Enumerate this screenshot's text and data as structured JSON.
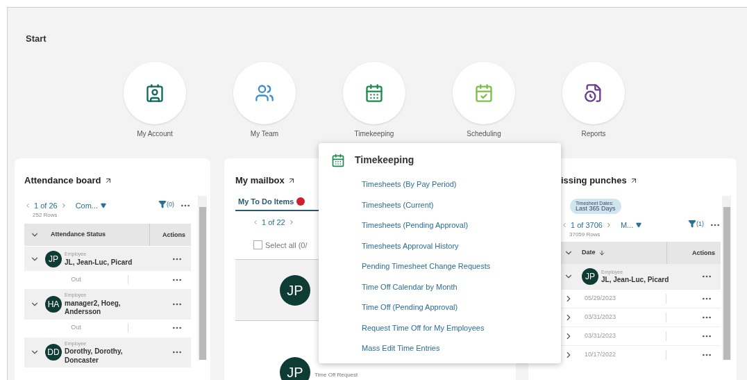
{
  "start": {
    "title": "Start",
    "tiles": [
      {
        "label": "My Account",
        "kind": "account"
      },
      {
        "label": "My Team",
        "kind": "team"
      },
      {
        "label": "Timekeeping",
        "kind": "timekeeping"
      },
      {
        "label": "Scheduling",
        "kind": "scheduling"
      },
      {
        "label": "Reports",
        "kind": "reports"
      }
    ]
  },
  "attendance_board": {
    "title": "Attendance board",
    "pager": "1 of 26",
    "row_count": "252 Rows",
    "view": "Com...",
    "filter_count": "(0)",
    "columns": [
      "Attendance Status",
      "Actions"
    ],
    "employees": [
      {
        "initials": "JP",
        "role": "Employee",
        "name": "JL, Jean-Luc, Picard",
        "expanded": true,
        "status": "Out"
      },
      {
        "initials": "HA",
        "role": "Employee",
        "name": "manager2, Hoeg, Andersson",
        "expanded": true,
        "status": "Out"
      },
      {
        "initials": "DD",
        "role": "Employee",
        "name": "Dorothy, Dorothy, Doncaster",
        "expanded": true
      }
    ]
  },
  "mailbox": {
    "title": "My mailbox",
    "tabs": [
      {
        "label": "My To Do Items",
        "selected": true
      }
    ],
    "pager": "1 of 22",
    "select_all": {
      "label": "Select all (0/",
      "checked": false
    },
    "items": [
      {
        "initials": "JP"
      },
      {
        "initials": "JP",
        "type": "Time Off Request"
      }
    ]
  },
  "missing_punches": {
    "title": "issing punches",
    "chip": [
      "Timesheet Dates:",
      "Last 365 Days"
    ],
    "pager": "1 of 3706",
    "row_count": "37059 Rows",
    "view": "M...",
    "filter_count": "(1)",
    "columns": [
      "Date",
      "Actions"
    ],
    "employee": {
      "initials": "JP",
      "role": "Employee",
      "name": "JL, Jean-Luc, Picard",
      "expanded": true
    },
    "rows": [
      {
        "date": "05/29/2023",
        "expanded": false
      },
      {
        "date": "03/31/2023",
        "expanded": false
      },
      {
        "date": "03/31/2023",
        "expanded": false
      },
      {
        "date": "10/17/2022",
        "expanded": false
      }
    ]
  },
  "timekeeping_menu": {
    "title": "Timekeeping",
    "links": [
      "Timesheets (By Pay Period)",
      "Timesheets (Current)",
      "Timesheets (Pending Approval)",
      "Timesheets Approval History",
      "Pending Timesheet Change Requests",
      "Time Off Calendar by Month",
      "Time Off (Pending Approval)",
      "Request Time Off for My Employees",
      "Mass Edit Time Entries"
    ]
  }
}
